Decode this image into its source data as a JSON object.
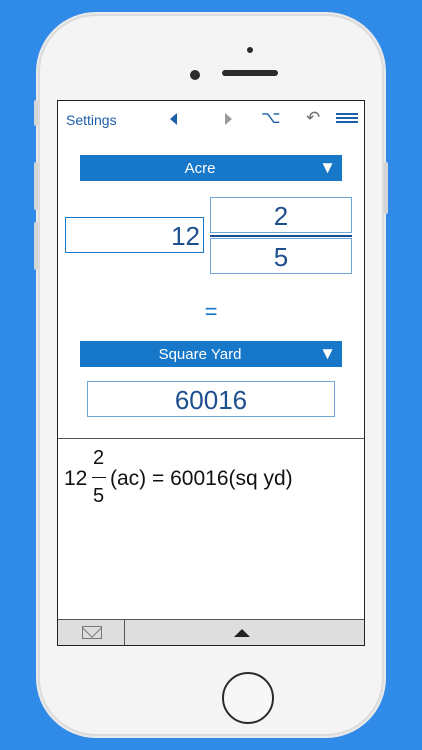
{
  "toolbar": {
    "settings_label": "Settings",
    "alt_symbol": "⌥",
    "undo_symbol": "↶"
  },
  "from_unit": {
    "label": "Acre",
    "arrow": "▼"
  },
  "to_unit": {
    "label": "Square Yard",
    "arrow": "▼"
  },
  "input": {
    "whole": "12",
    "numerator": "2",
    "denominator": "5"
  },
  "equals": "=",
  "result": "60016",
  "expression": {
    "whole": "12",
    "numerator": "2",
    "denominator": "5",
    "rest": "(ac) = 60016(sq yd)"
  },
  "colors": {
    "background": "#2f8ae8",
    "accent": "#1777c8",
    "text_dark": "#1d4f8f"
  }
}
